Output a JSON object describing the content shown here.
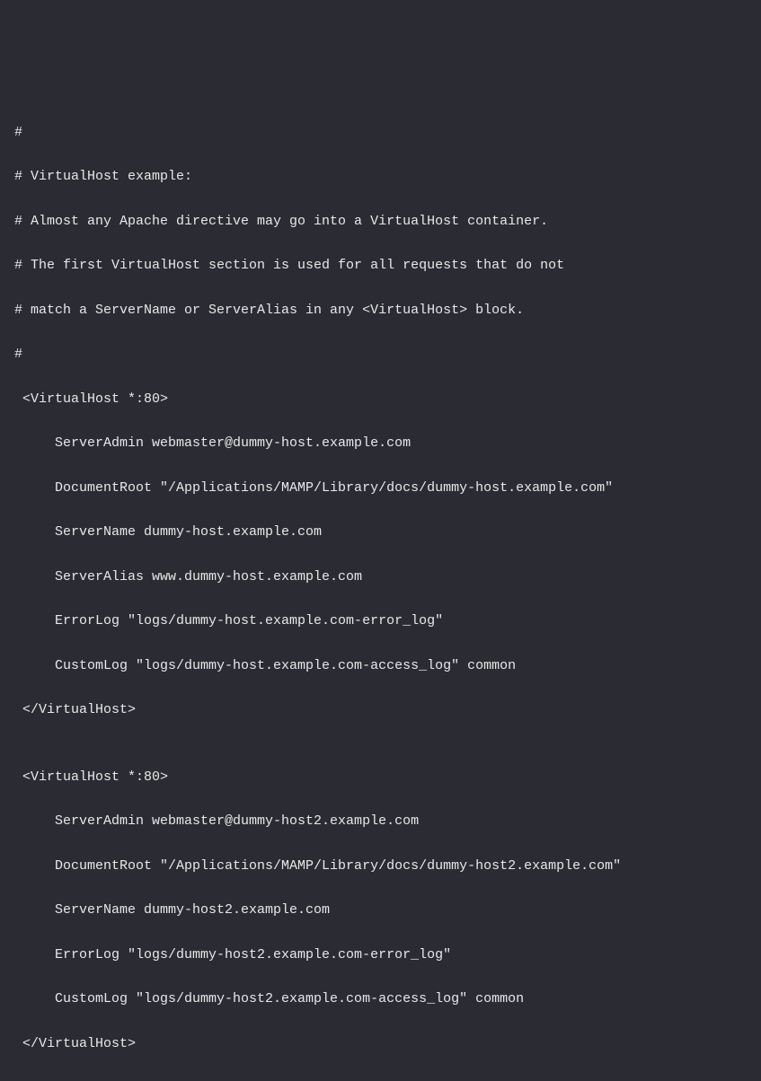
{
  "lines": [
    "#",
    "# VirtualHost example:",
    "# Almost any Apache directive may go into a VirtualHost container.",
    "# The first VirtualHost section is used for all requests that do not",
    "# match a ServerName or ServerAlias in any <VirtualHost> block.",
    "#",
    " <VirtualHost *:80>",
    "     ServerAdmin webmaster@dummy-host.example.com",
    "     DocumentRoot \"/Applications/MAMP/Library/docs/dummy-host.example.com\"",
    "     ServerName dummy-host.example.com",
    "     ServerAlias www.dummy-host.example.com",
    "     ErrorLog \"logs/dummy-host.example.com-error_log\"",
    "     CustomLog \"logs/dummy-host.example.com-access_log\" common",
    " </VirtualHost>",
    "",
    " <VirtualHost *:80>",
    "     ServerAdmin webmaster@dummy-host2.example.com",
    "     DocumentRoot \"/Applications/MAMP/Library/docs/dummy-host2.example.com\"",
    "     ServerName dummy-host2.example.com",
    "     ErrorLog \"logs/dummy-host2.example.com-error_log\"",
    "     CustomLog \"logs/dummy-host2.example.com-access_log\" common",
    " </VirtualHost>"
  ]
}
